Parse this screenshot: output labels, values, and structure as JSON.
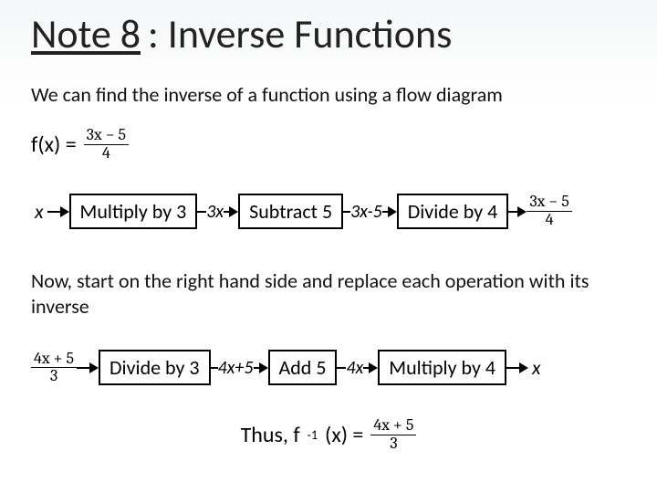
{
  "title": {
    "underlined": "Note 8",
    "rest": ":  Inverse Functions"
  },
  "intro": "We can find the inverse of a function using a flow diagram",
  "fx": {
    "label": "f(x) = ",
    "num": "3x − 5",
    "den": "4"
  },
  "flow1": {
    "start": "x",
    "op1": "Multiply by 3",
    "mid1": "3x",
    "op2": "Subtract 5",
    "mid2": "3x-5",
    "op3": "Divide by 4",
    "end_num": "3x − 5",
    "end_den": "4"
  },
  "midtext": "Now, start on the right hand side and replace each operation with its inverse",
  "flow2": {
    "start_num": "4x + 5",
    "start_den": "3",
    "op1": "Divide by 3",
    "mid1": "4x+5",
    "op2": "Add 5",
    "mid2": "4x",
    "op3": "Multiply by 4",
    "end": "x"
  },
  "result": {
    "prefix": "Thus, f",
    "sup": "-1",
    "suffix": "(x) = ",
    "num": "4x + 5",
    "den": "3"
  }
}
